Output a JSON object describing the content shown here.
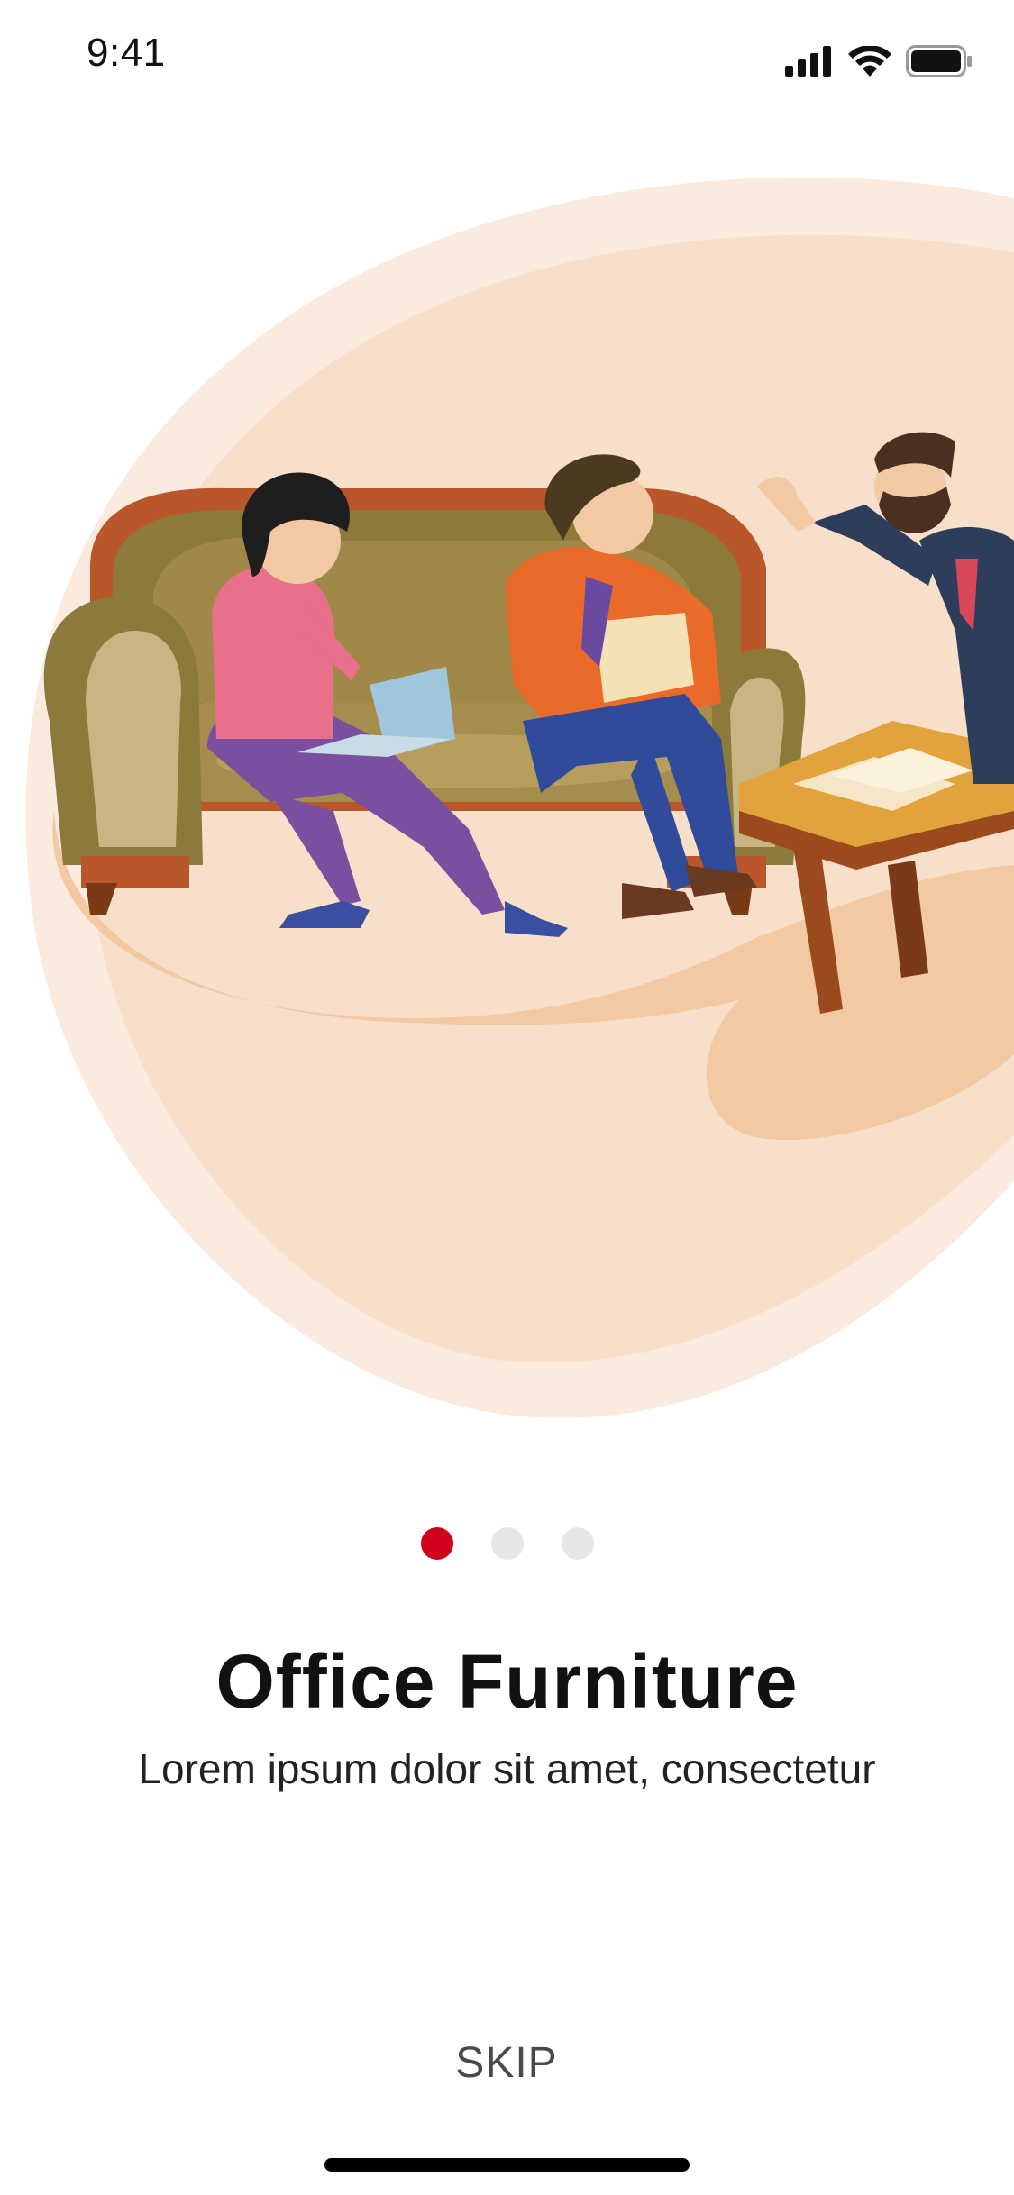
{
  "status_bar": {
    "time": "9:41",
    "icons": [
      "cellular-signal-icon",
      "wifi-icon",
      "battery-icon"
    ]
  },
  "onboarding": {
    "title": "Office Furniture",
    "subtitle": "Lorem ipsum dolor sit amet, consectetur",
    "skip_label": "SKIP",
    "pages": 3,
    "current_page": 1
  },
  "colors": {
    "accent": "#d0021b",
    "inactive_dot": "#e6e6e6",
    "blob_light": "#fbeade",
    "blob": "#f7dfc9",
    "blob_dark": "#f2c9a5"
  },
  "illustration": {
    "icon": "office-meeting-illustration"
  }
}
